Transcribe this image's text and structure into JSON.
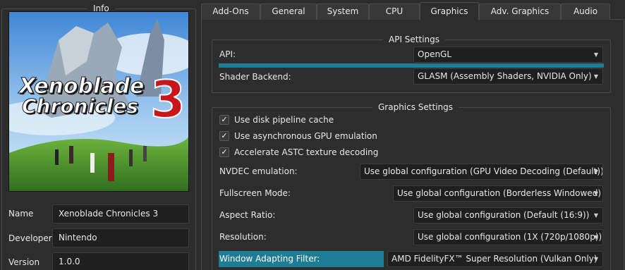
{
  "info": {
    "title": "Info",
    "name_label": "Name",
    "name_value": "Xenoblade Chronicles 3",
    "developer_label": "Developer",
    "developer_value": "Nintendo",
    "version_label": "Version",
    "version_value": "1.0.0",
    "cover_title_line1": "Xenoblade",
    "cover_title_line2": "Chronicles",
    "cover_title_number": "3"
  },
  "tabs": [
    {
      "label": "Add-Ons"
    },
    {
      "label": "General"
    },
    {
      "label": "System"
    },
    {
      "label": "CPU"
    },
    {
      "label": "Graphics",
      "active": true
    },
    {
      "label": "Adv. Graphics"
    },
    {
      "label": "Audio"
    }
  ],
  "api_settings": {
    "title": "API Settings",
    "api_label": "API:",
    "api_value": "OpenGL",
    "shader_label": "Shader Backend:",
    "shader_value": "GLASM (Assembly Shaders, NVIDIA Only)"
  },
  "graphics_settings": {
    "title": "Graphics Settings",
    "disk_cache_label": "Use disk pipeline cache",
    "disk_cache_checked": true,
    "async_gpu_label": "Use asynchronous GPU emulation",
    "async_gpu_checked": true,
    "astc_label": "Accelerate ASTC texture decoding",
    "astc_checked": true,
    "nvdec_label": "NVDEC emulation:",
    "nvdec_value": "Use global configuration (GPU Video Decoding (Default))",
    "fullscreen_label": "Fullscreen Mode:",
    "fullscreen_value": "Use global configuration (Borderless Windowed)",
    "aspect_label": "Aspect Ratio:",
    "aspect_value": "Use global configuration (Default (16:9))",
    "resolution_label": "Resolution:",
    "resolution_value": "Use global configuration (1X (720p/1080p))",
    "filter_label": "Window Adapting Filter:",
    "filter_value": "AMD FidelityFX™ Super Resolution (Vulkan Only)"
  },
  "colors": {
    "accent": "#1e7c95",
    "background": "#2d2d2d",
    "field": "#1f1f1f"
  }
}
